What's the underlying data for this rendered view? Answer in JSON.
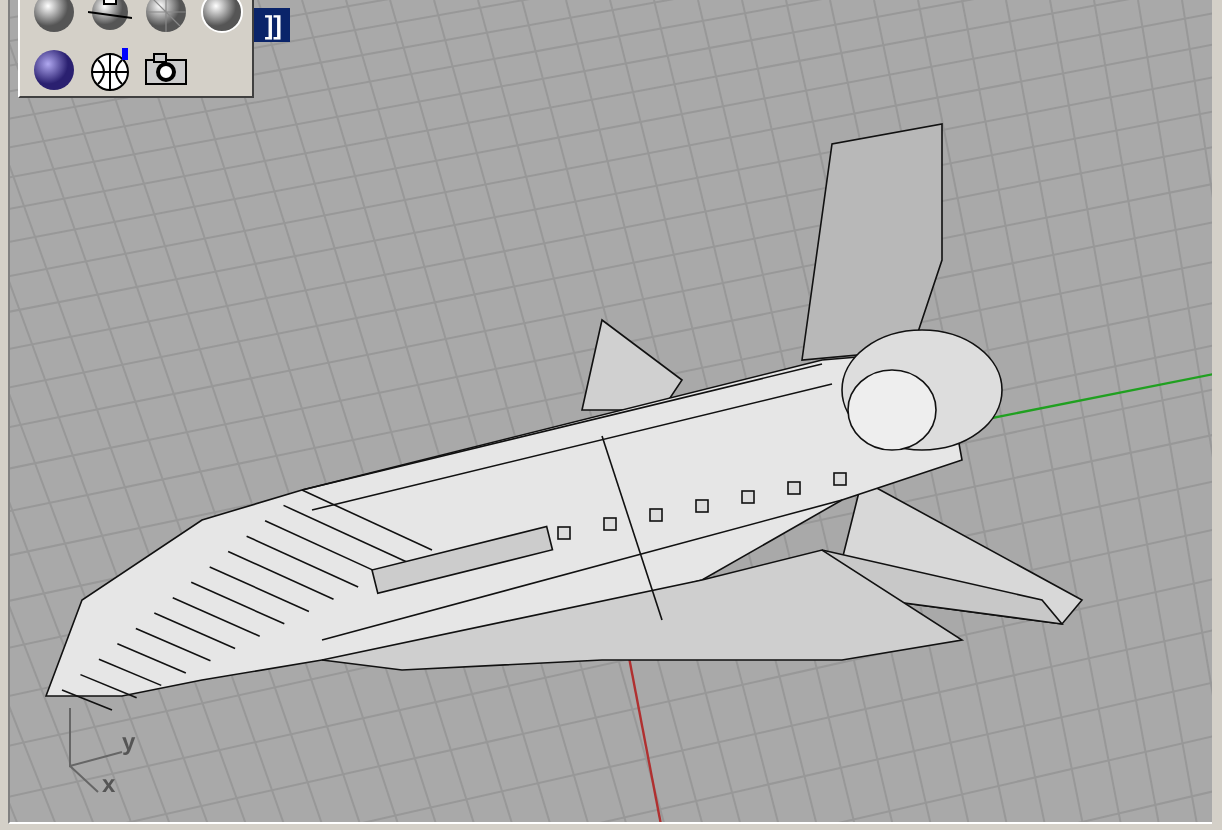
{
  "viewport": {
    "title": "]]"
  },
  "axis_gizmo": {
    "labels": [
      "y",
      "x"
    ]
  }
}
